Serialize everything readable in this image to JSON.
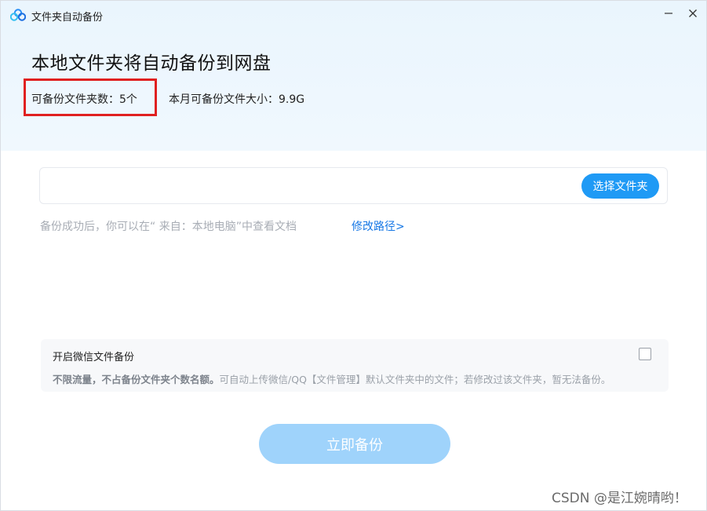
{
  "window": {
    "title": "文件夹自动备份",
    "minimize_glyph": "—",
    "close_glyph": "✕"
  },
  "header": {
    "heading": "本地文件夹将自动备份到网盘",
    "folder_count_label": "可备份文件夹数：5个",
    "monthly_size_label": "本月可备份文件大小：9.9G"
  },
  "folder_picker": {
    "value": "",
    "choose_button_label": "选择文件夹"
  },
  "hint": {
    "text": "备份成功后，你可以在“ 来自：本地电脑”中查看文档",
    "modify_path_link": "修改路径>"
  },
  "wechat_backup": {
    "title": "开启微信文件备份",
    "checked": false,
    "desc_bold": "不限流量，不占备份文件夹个数名额。",
    "desc_rest": "可自动上传微信/QQ【文件管理】默认文件夹中的文件；若修改过该文件夹，暂无法备份。"
  },
  "primary_action": {
    "label": "立即备份"
  },
  "watermark": "CSDN @是江婉晴哟！",
  "colors": {
    "accent": "#1f9af5",
    "accent_disabled": "#9fd3fb",
    "link": "#1677e5",
    "highlight": "#e02020",
    "header_bg": "#eaf5fd"
  },
  "icons": {
    "app_logo": "baidu-netdisk-cloud-icon",
    "minimize": "minimize-icon",
    "close": "close-icon"
  }
}
